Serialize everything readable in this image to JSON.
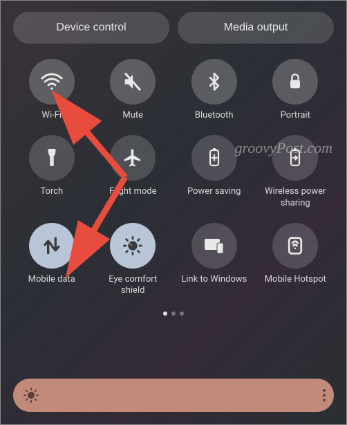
{
  "top_buttons": {
    "device_control": "Device control",
    "media_output": "Media output"
  },
  "tiles": [
    {
      "label": "Wi-Fi",
      "icon": "wifi-icon",
      "active": false
    },
    {
      "label": "Mute",
      "icon": "mute-icon",
      "active": false
    },
    {
      "label": "Bluetooth",
      "icon": "bluetooth-icon",
      "active": false
    },
    {
      "label": "Portrait",
      "icon": "lock-icon",
      "active": false
    },
    {
      "label": "Torch",
      "icon": "torch-icon",
      "active": false
    },
    {
      "label": "Flight mode",
      "icon": "airplane-icon",
      "active": false
    },
    {
      "label": "Power saving",
      "icon": "battery-icon",
      "active": false
    },
    {
      "label": "Wireless power sharing",
      "icon": "battery-share-icon",
      "active": false
    },
    {
      "label": "Mobile data",
      "icon": "data-arrows-icon",
      "active": true
    },
    {
      "label": "Eye comfort shield",
      "icon": "eye-comfort-icon",
      "active": true
    },
    {
      "label": "Link to Windows",
      "icon": "windows-link-icon",
      "active": false
    },
    {
      "label": "Mobile Hotspot",
      "icon": "hotspot-icon",
      "active": false
    }
  ],
  "watermark": "groovyPost.com",
  "pager": {
    "count": 3,
    "active": 0
  },
  "brightness": {
    "icon": "sun-icon"
  }
}
